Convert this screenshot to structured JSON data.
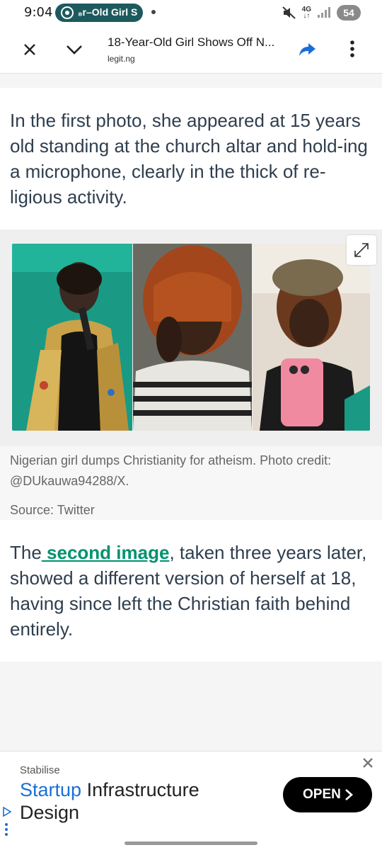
{
  "status_bar": {
    "time": "9:04",
    "pill_text": "₈r–Old Girl S",
    "network": "4G",
    "battery": "54"
  },
  "app_bar": {
    "title": "18-Year-Old Girl Shows Off N...",
    "url": "legit.ng"
  },
  "article": {
    "paragraph_1": "In the first photo, she appeared at 15 years old standing at the church altar and hold-ing a microphone, clearly in the thick of re-ligious activity.",
    "image_caption": "Nigerian girl dumps Christianity for atheism. Photo credit: @DUkauwa94288/X.",
    "image_source": "Source: Twitter",
    "paragraph_2_prefix": "The",
    "paragraph_2_link": " second image",
    "paragraph_2_suffix": ", taken three years later, showed a different version of herself at 18, having since left the Christian faith behind entirely."
  },
  "ad": {
    "brand": "Stabilise",
    "title_highlight": "Startup",
    "title_rest": " Infrastructure Design",
    "button_label": "OPEN"
  },
  "colors": {
    "accent_teal": "#00926e",
    "ad_link_blue": "#1a6fd6",
    "pill_bg": "#1d5a5e"
  }
}
